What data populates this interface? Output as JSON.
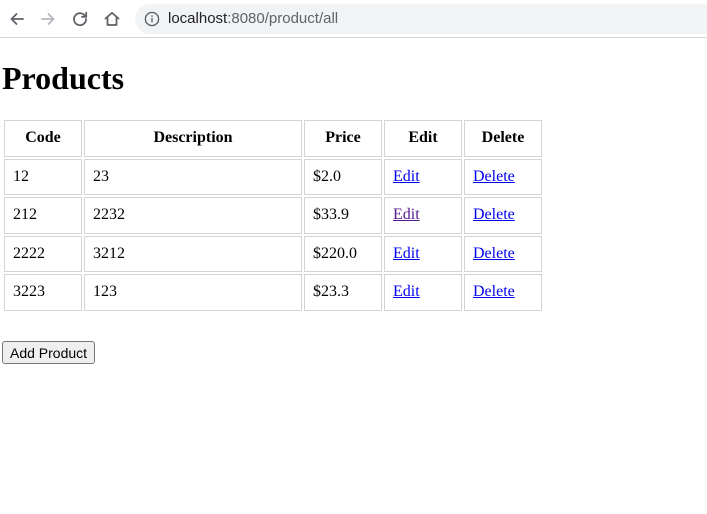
{
  "browser": {
    "url_host": "localhost",
    "url_path": ":8080/product/all"
  },
  "page": {
    "title": "Products",
    "table": {
      "headers": {
        "code": "Code",
        "description": "Description",
        "price": "Price",
        "edit": "Edit",
        "delete": "Delete"
      },
      "rows": [
        {
          "code": "12",
          "description": "23",
          "price": "$2.0",
          "edit": "Edit",
          "delete": "Delete",
          "edit_visited": false
        },
        {
          "code": "212",
          "description": "2232",
          "price": "$33.9",
          "edit": "Edit",
          "delete": "Delete",
          "edit_visited": true
        },
        {
          "code": "2222",
          "description": "3212",
          "price": "$220.0",
          "edit": "Edit",
          "delete": "Delete",
          "edit_visited": false
        },
        {
          "code": "3223",
          "description": "123",
          "price": "$23.3",
          "edit": "Edit",
          "delete": "Delete",
          "edit_visited": false
        }
      ]
    },
    "add_button_label": "Add Product"
  },
  "colors": {
    "link": "#0000ee",
    "link_visited": "#551a8b",
    "omnibox_bg": "#f1f3f4"
  },
  "icons": [
    "back-arrow-icon",
    "forward-arrow-icon",
    "reload-icon",
    "home-icon",
    "info-icon"
  ]
}
